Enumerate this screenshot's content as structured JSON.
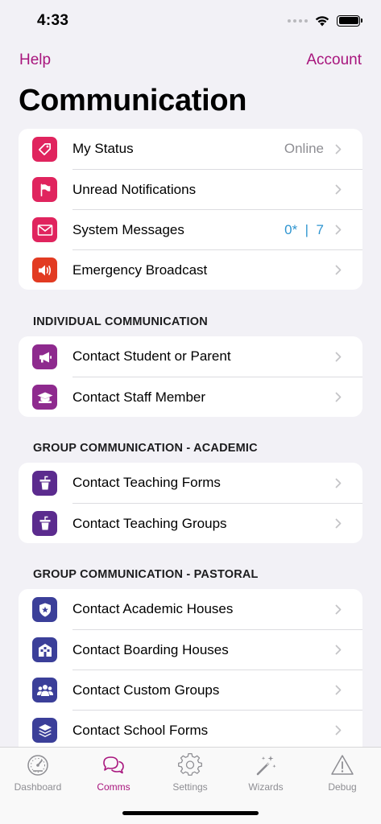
{
  "status_bar": {
    "time": "4:33"
  },
  "nav": {
    "left_label": "Help",
    "right_label": "Account"
  },
  "title": "Communication",
  "top_group": [
    {
      "label": "My Status",
      "value": "Online",
      "icon": "tag-icon",
      "color": "#e0245e"
    },
    {
      "label": "Unread Notifications",
      "value": "",
      "icon": "flag-icon",
      "color": "#e0245e"
    },
    {
      "label": "System Messages",
      "value": "0*  |  7",
      "icon": "envelope-icon",
      "color": "#e0245e"
    },
    {
      "label": "Emergency Broadcast",
      "value": "",
      "icon": "speaker-icon",
      "color": "#e23b22"
    }
  ],
  "sections": [
    {
      "header": "INDIVIDUAL COMMUNICATION",
      "items": [
        {
          "label": "Contact Student or Parent",
          "icon": "megaphone-icon",
          "color": "#8e2a8e"
        },
        {
          "label": "Contact Staff Member",
          "icon": "graduation-cap-icon",
          "color": "#8e2a8e"
        }
      ]
    },
    {
      "header": "GROUP COMMUNICATION - ACADEMIC",
      "items": [
        {
          "label": "Contact Teaching Forms",
          "icon": "podium-icon",
          "color": "#5b2b8e"
        },
        {
          "label": "Contact Teaching Groups",
          "icon": "podium-icon",
          "color": "#5b2b8e"
        }
      ]
    },
    {
      "header": "GROUP COMMUNICATION - PASTORAL",
      "items": [
        {
          "label": "Contact Academic Houses",
          "icon": "shield-star-icon",
          "color": "#3b3f99"
        },
        {
          "label": "Contact Boarding Houses",
          "icon": "house-icon",
          "color": "#3b3f99"
        },
        {
          "label": "Contact Custom Groups",
          "icon": "people-icon",
          "color": "#3b3f99"
        },
        {
          "label": "Contact School Forms",
          "icon": "layers-icon",
          "color": "#3b3f99"
        }
      ]
    }
  ],
  "tabs": [
    {
      "label": "Dashboard",
      "icon": "gauge-icon"
    },
    {
      "label": "Comms",
      "icon": "chat-bubbles-icon"
    },
    {
      "label": "Settings",
      "icon": "gear-icon"
    },
    {
      "label": "Wizards",
      "icon": "magic-wand-icon"
    },
    {
      "label": "Debug",
      "icon": "warning-icon"
    }
  ],
  "colors": {
    "accent": "#a8157d",
    "value_blue": "#2f95d0",
    "background": "#f2f1f6"
  }
}
